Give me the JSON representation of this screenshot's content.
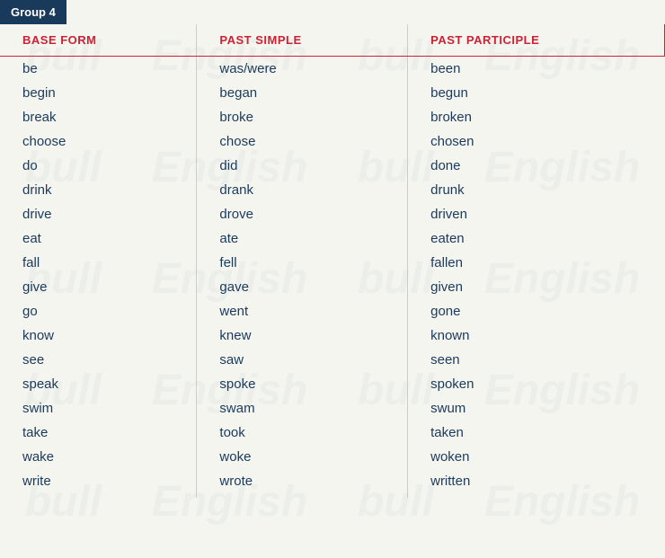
{
  "group": {
    "label": "Group 4"
  },
  "columns": {
    "base_form": "BASE FORM",
    "past_simple": "PAST SIMPLE",
    "past_participle": "PAST PARTICIPLE"
  },
  "rows": [
    {
      "base": "be",
      "past_simple": "was/were",
      "past_participle": "been"
    },
    {
      "base": "begin",
      "past_simple": "began",
      "past_participle": "begun"
    },
    {
      "base": "break",
      "past_simple": "broke",
      "past_participle": "broken"
    },
    {
      "base": "choose",
      "past_simple": "chose",
      "past_participle": "chosen"
    },
    {
      "base": "do",
      "past_simple": "did",
      "past_participle": "done"
    },
    {
      "base": "drink",
      "past_simple": "drank",
      "past_participle": "drunk"
    },
    {
      "base": "drive",
      "past_simple": "drove",
      "past_participle": "driven"
    },
    {
      "base": "eat",
      "past_simple": "ate",
      "past_participle": "eaten"
    },
    {
      "base": "fall",
      "past_simple": "fell",
      "past_participle": "fallen"
    },
    {
      "base": "give",
      "past_simple": "gave",
      "past_participle": "given"
    },
    {
      "base": "go",
      "past_simple": "went",
      "past_participle": "gone"
    },
    {
      "base": "know",
      "past_simple": "knew",
      "past_participle": "known"
    },
    {
      "base": "see",
      "past_simple": "saw",
      "past_participle": "seen"
    },
    {
      "base": "speak",
      "past_simple": "spoke",
      "past_participle": "spoken"
    },
    {
      "base": "swim",
      "past_simple": "swam",
      "past_participle": "swum"
    },
    {
      "base": "take",
      "past_simple": "took",
      "past_participle": "taken"
    },
    {
      "base": "wake",
      "past_simple": "woke",
      "past_participle": "woken"
    },
    {
      "base": "write",
      "past_simple": "wrote",
      "past_participle": "written"
    }
  ]
}
